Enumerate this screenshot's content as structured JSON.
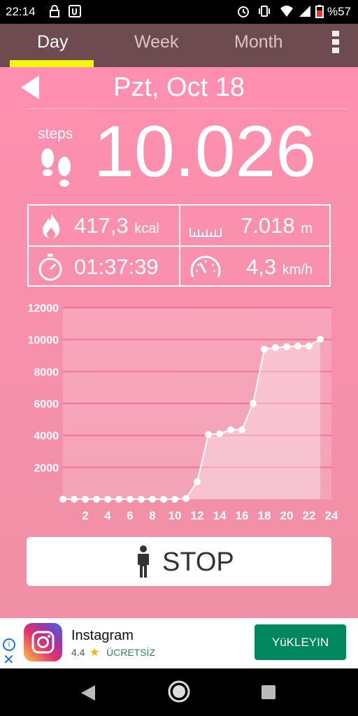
{
  "status_bar": {
    "time": "22:14",
    "battery": "%57"
  },
  "tabs": [
    {
      "label": "Day"
    },
    {
      "label": "Week"
    },
    {
      "label": "Month"
    }
  ],
  "date": "Pzt, Oct 18",
  "steps": {
    "label": "steps",
    "value": "10.026"
  },
  "stats": {
    "calories": {
      "value": "417,3",
      "unit": "kcal"
    },
    "distance": {
      "value": "7.018",
      "unit": "m"
    },
    "duration": {
      "value": "01:37:39"
    },
    "speed": {
      "value": "4,3",
      "unit": "km/h"
    }
  },
  "chart_data": {
    "type": "area",
    "x": [
      0,
      1,
      2,
      3,
      4,
      5,
      6,
      7,
      8,
      9,
      10,
      11,
      12,
      13,
      14,
      15,
      16,
      17,
      18,
      19,
      20,
      21,
      22,
      23
    ],
    "values": [
      0,
      0,
      0,
      0,
      0,
      0,
      0,
      0,
      0,
      0,
      0,
      50,
      1100,
      4050,
      4100,
      4350,
      4350,
      6000,
      9400,
      9500,
      9550,
      9600,
      9600,
      10026
    ],
    "xticks": [
      "2",
      "4",
      "6",
      "8",
      "10",
      "12",
      "14",
      "16",
      "18",
      "20",
      "22",
      "24"
    ],
    "yticks": [
      "2000",
      "4000",
      "6000",
      "8000",
      "10000",
      "12000"
    ],
    "xlim": [
      0,
      24
    ],
    "ylim": [
      0,
      12000
    ],
    "grid": true
  },
  "stop_button": {
    "label": "STOP"
  },
  "ad": {
    "title": "Instagram",
    "rating": "4.4",
    "price": "ÜCRETSİZ",
    "install_label": "YüKLEYIN"
  },
  "colors": {
    "accent": "#f4f60b",
    "tabbar": "#6d4b50",
    "background": "#f590ab",
    "ad_button": "#01875f"
  }
}
